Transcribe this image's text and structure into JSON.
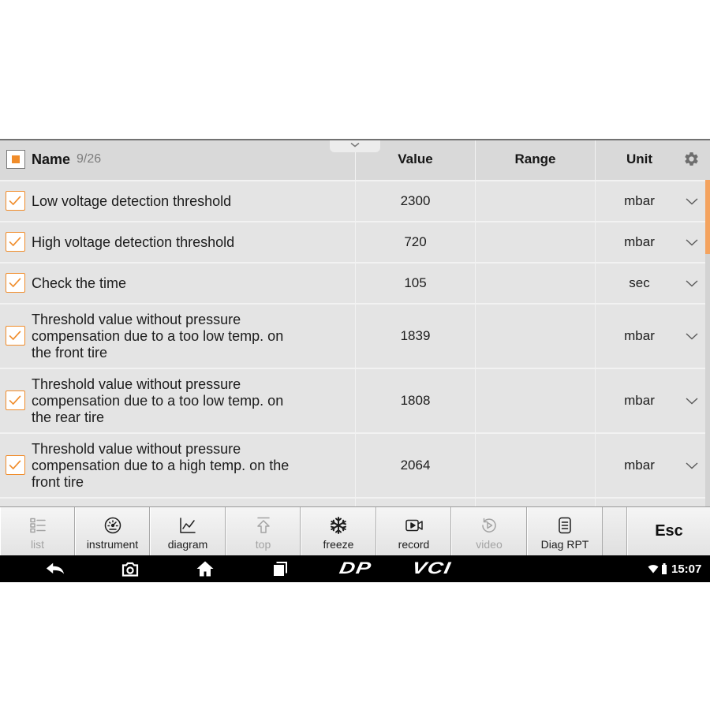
{
  "header": {
    "name_label": "Name",
    "count": "9/26",
    "value_label": "Value",
    "range_label": "Range",
    "unit_label": "Unit"
  },
  "rows": [
    {
      "name": "Low voltage detection threshold",
      "value": "2300",
      "unit": "mbar",
      "checked": true
    },
    {
      "name": "High voltage detection threshold",
      "value": "720",
      "unit": "mbar",
      "checked": true
    },
    {
      "name": "Check the time",
      "value": "105",
      "unit": "sec",
      "checked": true
    },
    {
      "name": "Threshold value without pressure compensation due to a too low temp. on the front tire",
      "value": "1839",
      "unit": "mbar",
      "checked": true
    },
    {
      "name": "Threshold value without pressure compensation due to a too low temp. on the rear tire",
      "value": "1808",
      "unit": "mbar",
      "checked": true
    },
    {
      "name": "Threshold value without pressure compensation due to a high temp. on the front tire",
      "value": "2064",
      "unit": "mbar",
      "checked": true
    }
  ],
  "toolbar": [
    {
      "label": "list",
      "icon": "list-icon",
      "disabled": true
    },
    {
      "label": "instrument",
      "icon": "gauge-icon",
      "disabled": false
    },
    {
      "label": "diagram",
      "icon": "line-chart-icon",
      "disabled": false
    },
    {
      "label": "top",
      "icon": "arrow-up-icon",
      "disabled": true
    },
    {
      "label": "freeze",
      "icon": "snowflake-icon",
      "disabled": false
    },
    {
      "label": "record",
      "icon": "video-camera-icon",
      "disabled": false
    },
    {
      "label": "video",
      "icon": "replay-icon",
      "disabled": true
    },
    {
      "label": "Diag RPT",
      "icon": "document-icon",
      "disabled": false
    }
  ],
  "esc_label": "Esc",
  "navbar": {
    "icons": [
      "back-arrow-icon",
      "camera-icon",
      "home-icon",
      "recent-apps-icon",
      "wifi-icon",
      "battery-icon"
    ],
    "dp_logo": "DP",
    "vci_logo": "VCI",
    "time": "15:07"
  },
  "colors": {
    "accent": "#f08c2a",
    "header_bg": "#d9d9d9",
    "row_bg": "#e4e4e4",
    "scroll_thumb": "#f4a35f",
    "disabled": "#a3a3a3",
    "navbar_bg": "#000000"
  }
}
